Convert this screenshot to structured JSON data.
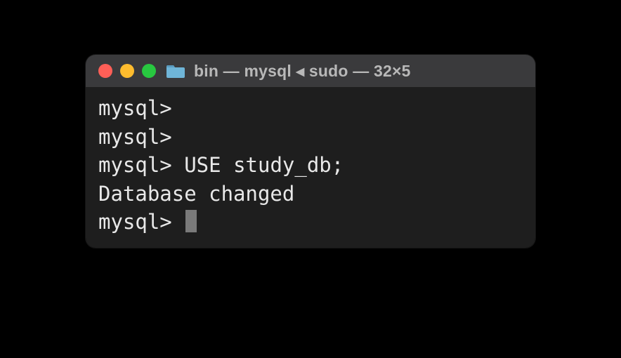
{
  "titlebar": {
    "title": "bin — mysql ◂ sudo — 32×5"
  },
  "terminal": {
    "lines": [
      {
        "prompt": "mysql>",
        "command": ""
      },
      {
        "prompt": "mysql>",
        "command": ""
      },
      {
        "prompt": "mysql>",
        "command": " USE study_db;"
      },
      {
        "output": "Database changed"
      },
      {
        "prompt": "mysql>",
        "command": " ",
        "cursor": true
      }
    ]
  },
  "colors": {
    "close": "#ff5f57",
    "minimize": "#febc2e",
    "maximize": "#28c840",
    "titlebar_bg": "#3a3a3c",
    "body_bg": "#1e1e1e",
    "text": "#e8e8e8"
  }
}
